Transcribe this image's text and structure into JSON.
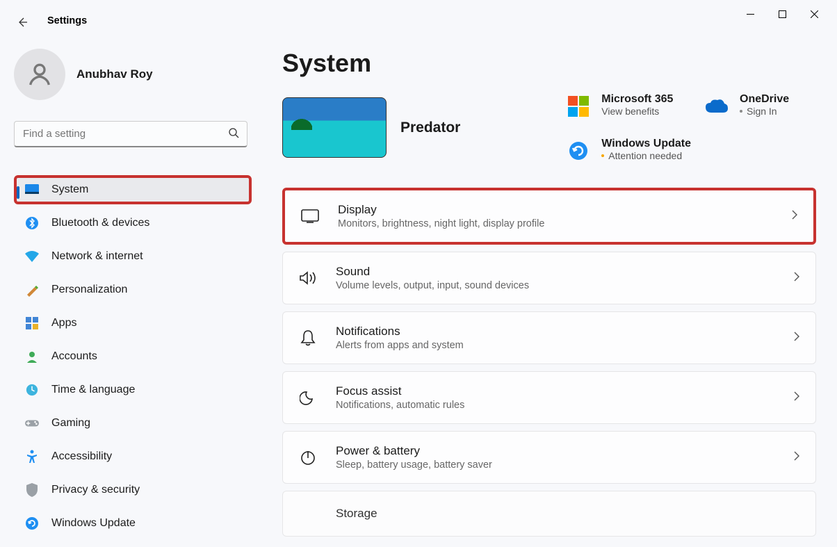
{
  "window": {
    "title": "Settings"
  },
  "user": {
    "name": "Anubhav Roy"
  },
  "search": {
    "placeholder": "Find a setting"
  },
  "nav": [
    {
      "id": "system",
      "label": "System",
      "active": true
    },
    {
      "id": "bluetooth",
      "label": "Bluetooth & devices"
    },
    {
      "id": "network",
      "label": "Network & internet"
    },
    {
      "id": "personalization",
      "label": "Personalization"
    },
    {
      "id": "apps",
      "label": "Apps"
    },
    {
      "id": "accounts",
      "label": "Accounts"
    },
    {
      "id": "time",
      "label": "Time & language"
    },
    {
      "id": "gaming",
      "label": "Gaming"
    },
    {
      "id": "accessibility",
      "label": "Accessibility"
    },
    {
      "id": "privacy",
      "label": "Privacy & security"
    },
    {
      "id": "update",
      "label": "Windows Update"
    }
  ],
  "page": {
    "title": "System"
  },
  "device": {
    "name": "Predator"
  },
  "stats": {
    "m365": {
      "title": "Microsoft 365",
      "sub": "View benefits"
    },
    "update": {
      "title": "Windows Update",
      "sub": "Attention needed"
    },
    "onedrive": {
      "title": "OneDrive",
      "sub": "Sign In"
    }
  },
  "items": [
    {
      "id": "display",
      "title": "Display",
      "sub": "Monitors, brightness, night light, display profile",
      "highlighted": true
    },
    {
      "id": "sound",
      "title": "Sound",
      "sub": "Volume levels, output, input, sound devices"
    },
    {
      "id": "notifications",
      "title": "Notifications",
      "sub": "Alerts from apps and system"
    },
    {
      "id": "focus",
      "title": "Focus assist",
      "sub": "Notifications, automatic rules"
    },
    {
      "id": "power",
      "title": "Power & battery",
      "sub": "Sleep, battery usage, battery saver"
    },
    {
      "id": "storage",
      "title": "Storage",
      "sub": ""
    }
  ],
  "highlights": {
    "sidebar": "system",
    "content": "display"
  }
}
